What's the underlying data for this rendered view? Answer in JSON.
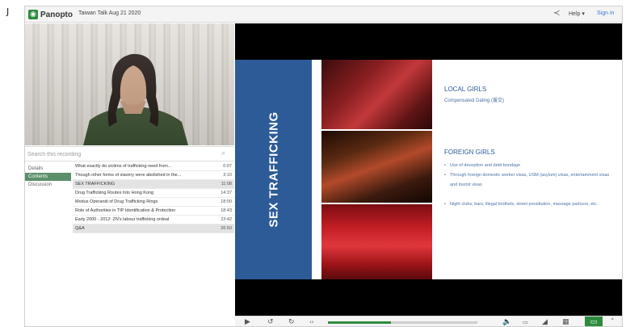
{
  "window": {
    "brand": "Panopto",
    "session_title": "Taiwan Talk Aug 21 2020",
    "help_label": "Help",
    "signin_label": "Sign in"
  },
  "search": {
    "placeholder": "Search this recording"
  },
  "tabs": [
    "Details",
    "Contents",
    "Discussion"
  ],
  "active_tab": "Contents",
  "contents": [
    {
      "title": "What exactly do victims of trafficking need from...",
      "time": "0:07",
      "highlight": false
    },
    {
      "title": "Though other forms of slavery were abolished in the...",
      "time": "3:10",
      "highlight": false
    },
    {
      "title": "SEX TRAFFICKING",
      "time": "11:08",
      "highlight": true
    },
    {
      "title": "Drug Trafficking Routes Into Hong Kong",
      "time": "14:37",
      "highlight": false
    },
    {
      "title": "Modus Operandi of Drug Trafficking Rings",
      "time": "18:00",
      "highlight": false
    },
    {
      "title": "Role of Authorities in TIP Identification & Protection",
      "time": "18:43",
      "highlight": false
    },
    {
      "title": "Early 2000 - 2012: ZN's labour trafficking ordeal",
      "time": "23:42",
      "highlight": false
    },
    {
      "title": "Q&A",
      "time": "26:50",
      "highlight": true
    }
  ],
  "slide": {
    "vertical_title": "SEX TRAFFICKING",
    "local_heading": "LOCAL GIRLS",
    "local_sub": "Compensated Dating (援交)",
    "foreign_heading": "FOREIGN GIRLS",
    "bullets": [
      "Use of deception and debt bondage",
      "Through foreign domestic worker visas, USM (asylum) visas, entertainment visas and tourist visas",
      "Night clubs, bars, illegal brothels, street prostitution, massage parlours, etc."
    ]
  },
  "colors": {
    "brand_green": "#2e8b3e",
    "slide_blue": "#2c5b98",
    "tab_active": "#5a8f6a"
  },
  "player": {
    "progress_fraction": 0.42
  }
}
